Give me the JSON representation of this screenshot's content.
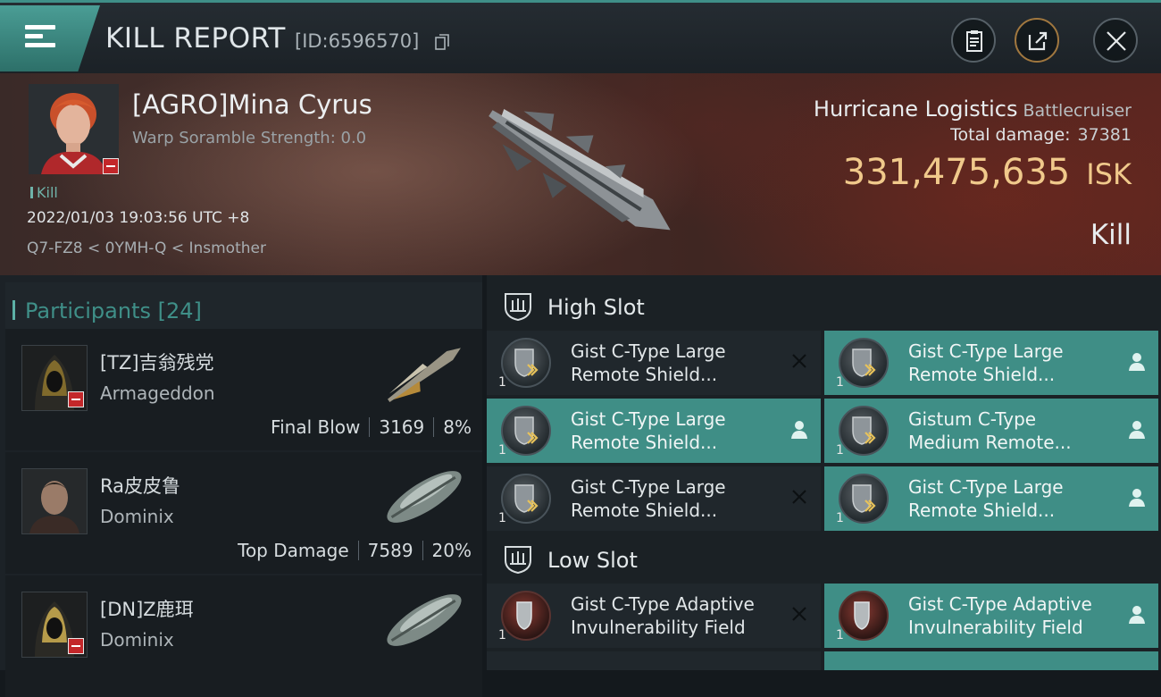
{
  "header": {
    "title": "KILL REPORT",
    "report_id": "[ID:6596570]",
    "icons": [
      "menu-icon",
      "copy-icon",
      "clipboard-icon",
      "share-icon",
      "close-icon"
    ]
  },
  "victim": {
    "pilot_name": "[AGRO]Mina Cyrus",
    "warp_scramble": "Warp Soramble Strength: 0.0",
    "tag": "Kill",
    "datetime": "2022/01/03 19:03:56 UTC +8",
    "route": "Q7-FZ8 < 0YMH-Q < Insmother",
    "ship_name": "Hurricane Logistics",
    "ship_class": "Battlecruiser",
    "total_damage_label": "Total damage:",
    "total_damage": "37381",
    "isk_value": "331,475,635",
    "isk_unit": "ISK",
    "result": "Kill"
  },
  "participants": {
    "label": "Participants",
    "count": "[24]",
    "rows": [
      {
        "name": "[TZ]吉翁残党",
        "ship": "Armageddon",
        "role": "Final Blow",
        "damage": "3169",
        "percent": "8%"
      },
      {
        "name": "Ra皮皮鲁",
        "ship": "Dominix",
        "role": "Top Damage",
        "damage": "7589",
        "percent": "20%"
      },
      {
        "name": "[DN]Z鹿珥",
        "ship": "Dominix",
        "role": "",
        "damage": "",
        "percent": ""
      }
    ]
  },
  "slots": {
    "high_label": "High Slot",
    "low_label": "Low Slot",
    "high": [
      {
        "line1": "Gist C-Type Large",
        "line2": "Remote Shield...",
        "qty": "1",
        "state": "destroyed"
      },
      {
        "line1": "Gist C-Type Large",
        "line2": "Remote Shield...",
        "qty": "1",
        "state": "dropped"
      },
      {
        "line1": "Gist C-Type Large",
        "line2": "Remote Shield...",
        "qty": "1",
        "state": "dropped"
      },
      {
        "line1": "Gistum C-Type",
        "line2": "Medium Remote...",
        "qty": "1",
        "state": "dropped"
      },
      {
        "line1": "Gist C-Type Large",
        "line2": "Remote Shield...",
        "qty": "1",
        "state": "destroyed"
      },
      {
        "line1": "Gist C-Type Large",
        "line2": "Remote Shield...",
        "qty": "1",
        "state": "dropped"
      }
    ],
    "low": [
      {
        "line1": "Gist C-Type Adaptive",
        "line2": "Invulnerability Field",
        "qty": "1",
        "state": "destroyed"
      },
      {
        "line1": "Gist C-Type Adaptive",
        "line2": "Invulnerability Field",
        "qty": "1",
        "state": "dropped"
      }
    ]
  },
  "colors": {
    "accent": "#3f8e86",
    "isk": "#f0c98b",
    "badge_red": "#c3272a"
  }
}
